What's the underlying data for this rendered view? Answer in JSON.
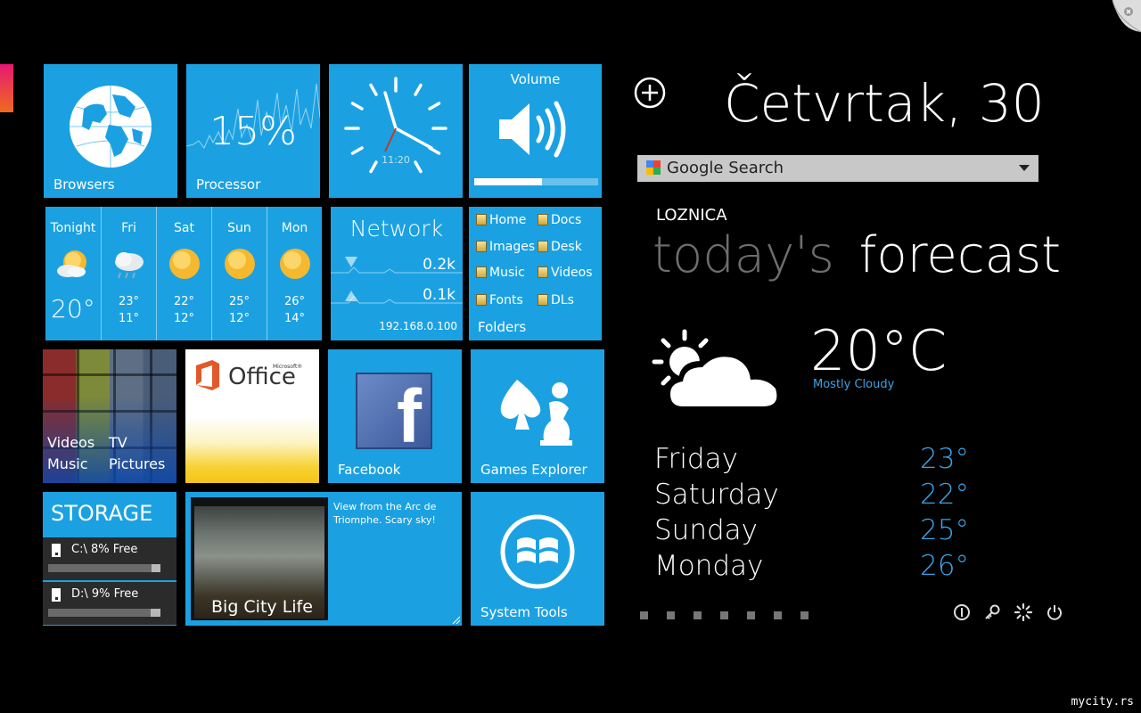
{
  "tiles": {
    "browsers": {
      "label": "Browsers"
    },
    "processor": {
      "label": "Processor",
      "value": "15%"
    },
    "clock": {
      "time": "11:20"
    },
    "volume": {
      "title": "Volume",
      "level": 0.55
    },
    "weather": {
      "days": [
        {
          "day": "Tonight",
          "temp": "20°",
          "icon": "partly-sunny-icon"
        },
        {
          "day": "Fri",
          "hi": "23°",
          "lo": "11°",
          "icon": "cloudy-rain-icon"
        },
        {
          "day": "Sat",
          "hi": "22°",
          "lo": "12°",
          "icon": "sunny-icon"
        },
        {
          "day": "Sun",
          "hi": "25°",
          "lo": "12°",
          "icon": "sunny-icon"
        },
        {
          "day": "Mon",
          "hi": "26°",
          "lo": "14°",
          "icon": "sunny-icon"
        }
      ]
    },
    "network": {
      "title": "Network",
      "down": "0.2k",
      "up": "0.1k",
      "ip": "192.168.0.100"
    },
    "folders": {
      "title": "Folders",
      "items": [
        "Home",
        "Docs",
        "Images",
        "Desk",
        "Music",
        "Videos",
        "Fonts",
        "DLs"
      ]
    },
    "media": {
      "videos": "Videos",
      "tv": "TV",
      "music": "Music",
      "pictures": "Pictures"
    },
    "office": {
      "microsoft": "Microsoft®",
      "name": "Office"
    },
    "facebook": {
      "label": "Facebook",
      "letter": "f"
    },
    "games": {
      "label": "Games Explorer"
    },
    "storage": {
      "title": "STORAGE",
      "drives": [
        {
          "label": "C:\\ 8% Free",
          "free": 0.08
        },
        {
          "label": "D:\\ 9% Free",
          "free": 0.09
        }
      ]
    },
    "photo": {
      "caption": "Big City Life",
      "description": "View from the Arc de Triomphe.  Scary sky!"
    },
    "system": {
      "label": "System Tools"
    }
  },
  "right": {
    "date": "Četvrtak, 30",
    "search": {
      "engine": "Google Search"
    },
    "city": "LOZNICA",
    "heading_today": "today's",
    "heading_forecast": "forecast",
    "current": {
      "temp": "20°C",
      "condition": "Mostly Cloudy"
    },
    "forecast": [
      {
        "day": "Friday",
        "temp": "23°"
      },
      {
        "day": "Saturday",
        "temp": "22°"
      },
      {
        "day": "Sunday",
        "temp": "25°"
      },
      {
        "day": "Monday",
        "temp": "26°"
      }
    ],
    "page_dots": 7,
    "system_buttons": [
      "info-icon",
      "key-icon",
      "loading-icon",
      "power-icon"
    ]
  },
  "watermark": "mycity.rs",
  "colors": {
    "tile": "#1ba1e2",
    "accent_temp": "#3ba4e6"
  }
}
